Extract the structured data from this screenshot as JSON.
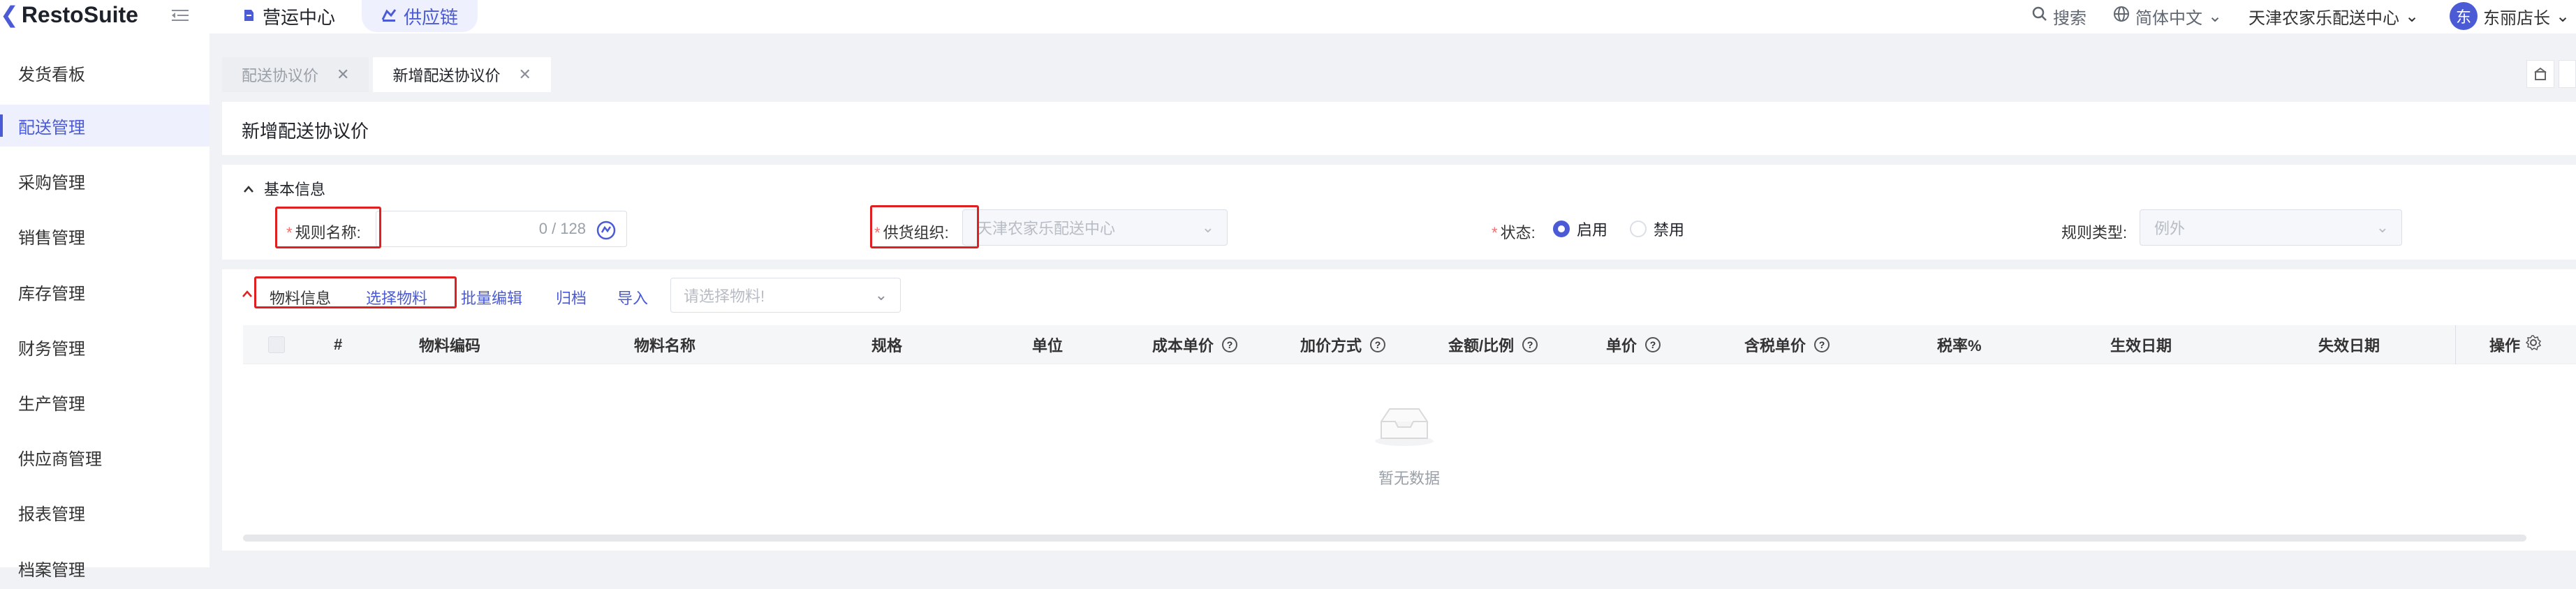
{
  "brand": {
    "name": "RestoSuite"
  },
  "topnav": {
    "tabs": [
      {
        "label": "营运中心",
        "icon": "operation-icon"
      },
      {
        "label": "供应链",
        "icon": "supply-chain-icon"
      }
    ],
    "search_label": "搜索",
    "language": "简体中文",
    "org": "天津农家乐配送中心",
    "avatar_char": "东",
    "user": "东丽店长"
  },
  "sidebar": {
    "items": [
      {
        "label": "发货看板"
      },
      {
        "label": "配送管理"
      },
      {
        "label": "采购管理"
      },
      {
        "label": "销售管理"
      },
      {
        "label": "库存管理"
      },
      {
        "label": "财务管理"
      },
      {
        "label": "生产管理"
      },
      {
        "label": "供应商管理"
      },
      {
        "label": "报表管理"
      },
      {
        "label": "档案管理"
      }
    ],
    "active_index": 1
  },
  "page_tabs": [
    {
      "label": "配送协议价"
    },
    {
      "label": "新增配送协议价"
    }
  ],
  "page": {
    "title": "新增配送协议价"
  },
  "basic": {
    "section_title": "基本信息",
    "rule_name_label": "规则名称:",
    "rule_name_counter": "0 / 128",
    "supplier_org_label": "供货组织:",
    "supplier_org_value": "天津农家乐配送中心",
    "status_label": "状态:",
    "status_options": [
      "启用",
      "禁用"
    ],
    "status_selected": "启用",
    "rule_type_label": "规则类型:",
    "rule_type_value": "例外"
  },
  "material": {
    "tab_info": "物料信息",
    "tab_select": "选择物料",
    "batch_edit": "批量编辑",
    "archive": "归档",
    "import": "导入",
    "select_placeholder": "请选择物料!",
    "columns": [
      "#",
      "物料编码",
      "物料名称",
      "规格",
      "单位",
      "成本单价",
      "加价方式",
      "金额/比例",
      "单价",
      "含税单价",
      "税率%",
      "生效日期",
      "失效日期",
      "操作"
    ],
    "empty_text": "暂无数据"
  },
  "colors": {
    "accent": "#4b5bd6",
    "highlight": "#e02020",
    "required": "#f56c6c"
  }
}
